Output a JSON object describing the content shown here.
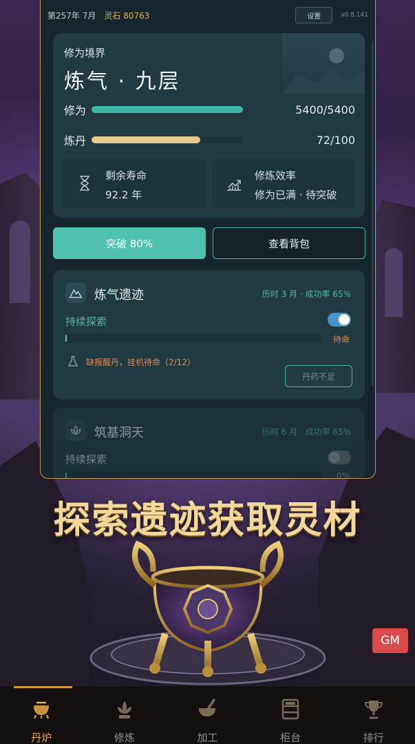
{
  "topbar": {
    "date": "第257年 7月",
    "spirit_stone": "灵石 80763",
    "settings": "设置",
    "version": "v0.8.141"
  },
  "realm": {
    "label": "修为境界",
    "name": "炼气 · 九层",
    "cultivation_label": "修为",
    "cultivation_value": "5400/5400",
    "cultivation_fraction": 1.0,
    "dan_label": "炼丹",
    "dan_value": "72/100",
    "dan_fraction": 0.72,
    "lifespan_title": "剩余寿命",
    "lifespan_value": "92.2 年",
    "efficiency_title": "修炼效率",
    "efficiency_value": "修为已满 · 待突破"
  },
  "actions": {
    "breakthrough": "突破 80%",
    "view_bag": "查看背包"
  },
  "ruins": [
    {
      "title": "炼气遗迹",
      "meta": "历时 3 月 · 成功率 65%",
      "explore_label": "持续探索",
      "toggle_on": true,
      "progress_status": "待命",
      "warning": "缺报醒丹，挂机待命（2/12）",
      "button": "丹药不足"
    },
    {
      "title": "筑基洞天",
      "meta": "历时 6 月 · 成功率 65%",
      "explore_label": "持续探索",
      "toggle_on": false,
      "progress_status": "0%"
    }
  ],
  "headline": "探索遗迹获取灵材",
  "gm_button": "GM",
  "nav": [
    {
      "label": "丹炉",
      "icon": "cauldron-icon",
      "active": true
    },
    {
      "label": "修炼",
      "icon": "lotus-icon",
      "active": false
    },
    {
      "label": "加工",
      "icon": "mortar-icon",
      "active": false
    },
    {
      "label": "柜台",
      "icon": "cabinet-icon",
      "active": false
    },
    {
      "label": "排行",
      "icon": "trophy-icon",
      "active": false
    }
  ],
  "colors": {
    "accent_teal": "#4fc1ad",
    "gold": "#d9b45c",
    "warning_orange": "#d9895a",
    "gm_red": "#d94a4a",
    "nav_active": "#e2a64b"
  }
}
